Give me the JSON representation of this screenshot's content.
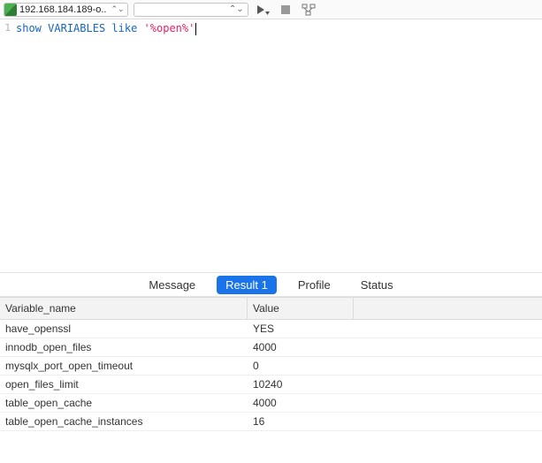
{
  "toolbar": {
    "connection_label": "192.168.184.189-o..",
    "combo_value": "",
    "combo_chevron": "⌃⌄"
  },
  "editor": {
    "line_number": "1",
    "tokens": {
      "t1": "show",
      "t2": "VARIABLES",
      "t3": "like",
      "t4": "'%open%'"
    }
  },
  "tabs": {
    "message": "Message",
    "result1": "Result 1",
    "profile": "Profile",
    "status": "Status"
  },
  "grid": {
    "header": {
      "col1": "Variable_name",
      "col2": "Value"
    },
    "rows": [
      {
        "name": "have_openssl",
        "value": "YES"
      },
      {
        "name": "innodb_open_files",
        "value": "4000"
      },
      {
        "name": "mysqlx_port_open_timeout",
        "value": "0"
      },
      {
        "name": "open_files_limit",
        "value": "10240"
      },
      {
        "name": "table_open_cache",
        "value": "4000"
      },
      {
        "name": "table_open_cache_instances",
        "value": "16"
      }
    ]
  }
}
